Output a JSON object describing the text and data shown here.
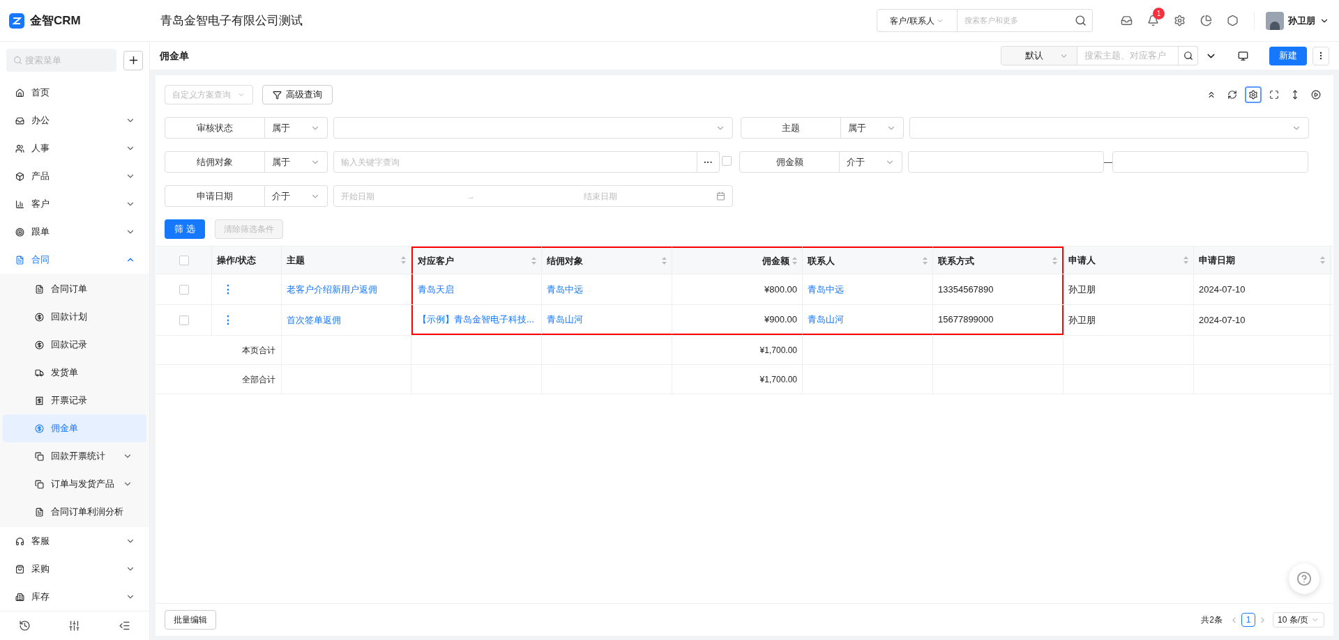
{
  "header": {
    "logo": "金智CRM",
    "company": "青岛金智电子有限公司测试",
    "search_scope": "客户/联系人",
    "search_placeholder": "搜索客户和更多",
    "notification_count": "1",
    "user": "孙卫朋"
  },
  "sidebar": {
    "search_placeholder": "搜索菜单",
    "items": [
      {
        "label": "首页",
        "kind": "link",
        "selected": false
      },
      {
        "label": "办公",
        "kind": "group",
        "expanded": false,
        "selected": false
      },
      {
        "label": "人事",
        "kind": "group",
        "expanded": false,
        "selected": false
      },
      {
        "label": "产品",
        "kind": "group",
        "expanded": false,
        "selected": false
      },
      {
        "label": "客户",
        "kind": "group",
        "expanded": false,
        "selected": false
      },
      {
        "label": "跟单",
        "kind": "group",
        "expanded": false,
        "selected": false
      },
      {
        "label": "合同",
        "kind": "group",
        "expanded": true,
        "selected": true,
        "children": [
          {
            "label": "合同订单",
            "kind": "link",
            "selected": false
          },
          {
            "label": "回款计划",
            "kind": "link",
            "selected": false
          },
          {
            "label": "回款记录",
            "kind": "link",
            "selected": false
          },
          {
            "label": "发货单",
            "kind": "link",
            "selected": false
          },
          {
            "label": "开票记录",
            "kind": "link",
            "selected": false
          },
          {
            "label": "佣金单",
            "kind": "link",
            "selected": true
          },
          {
            "label": "回款开票统计",
            "kind": "group",
            "expanded": false,
            "selected": false
          },
          {
            "label": "订单与发货产品",
            "kind": "group",
            "expanded": false,
            "selected": false
          },
          {
            "label": "合同订单利润分析",
            "kind": "link",
            "selected": false
          }
        ]
      },
      {
        "label": "客服",
        "kind": "group",
        "expanded": false,
        "selected": false
      },
      {
        "label": "采购",
        "kind": "group",
        "expanded": false,
        "selected": false
      },
      {
        "label": "库存",
        "kind": "group",
        "expanded": false,
        "selected": false
      }
    ]
  },
  "page": {
    "title": "佣金单",
    "view": "默认",
    "search_placeholder": "搜索主题、对应客户",
    "new_button": "新建"
  },
  "toolbar": {
    "scheme_placeholder": "自定义方案查询",
    "advanced": "高级查询",
    "tools": [
      {
        "selected": false
      },
      {
        "selected": false
      },
      {
        "selected": true
      },
      {
        "selected": false
      },
      {
        "selected": false
      },
      {
        "selected": false
      }
    ]
  },
  "filters": [
    {
      "label": "审核状态",
      "operator": "属于",
      "kind": "select"
    },
    {
      "label": "主题",
      "operator": "属于",
      "kind": "select"
    },
    {
      "label": "结佣对象",
      "operator": "属于",
      "kind": "keyword",
      "placeholder": "输入关键字查询",
      "more": "···",
      "checked": false
    },
    {
      "label": "佣金额",
      "operator": "介于",
      "kind": "range",
      "separator": "—"
    },
    {
      "label": "申请日期",
      "operator": "介于",
      "kind": "daterange",
      "start_placeholder": "开始日期",
      "end_placeholder": "结束日期",
      "separator": "→"
    }
  ],
  "filter_actions": {
    "apply": "筛 选",
    "clear": "清除筛选条件",
    "clear_disabled": true
  },
  "table": {
    "select_all_checked": false,
    "columns": [
      {
        "label": "操作/状态",
        "kind": "menu",
        "sortable": false,
        "highlighted": false
      },
      {
        "label": "主题",
        "kind": "link",
        "sortable": true,
        "highlighted": false
      },
      {
        "label": "对应客户",
        "kind": "link",
        "sortable": true,
        "highlighted": true
      },
      {
        "label": "结佣对象",
        "kind": "link",
        "sortable": true,
        "highlighted": true
      },
      {
        "label": "佣金额",
        "kind": "amount",
        "sortable": true,
        "highlighted": true
      },
      {
        "label": "联系人",
        "kind": "link",
        "sortable": true,
        "highlighted": true
      },
      {
        "label": "联系方式",
        "kind": "text",
        "sortable": true,
        "highlighted": true
      },
      {
        "label": "申请人",
        "kind": "text",
        "sortable": true,
        "highlighted": false
      },
      {
        "label": "申请日期",
        "kind": "text",
        "sortable": true,
        "highlighted": false
      }
    ],
    "rows": [
      {
        "checked": false,
        "cells": [
          "⋮",
          "老客户介绍新用户返佣",
          "青岛天启",
          "青岛中远",
          "¥800.00",
          "青岛中远",
          "13354567890",
          "孙卫朋",
          "2024-07-10"
        ]
      },
      {
        "checked": false,
        "cells": [
          "⋮",
          "首次签单返佣",
          "【示例】青岛金智电子科技...",
          "青岛山河",
          "¥900.00",
          "青岛山河",
          "15677899000",
          "孙卫朋",
          "2024-07-10"
        ]
      }
    ],
    "totals": [
      {
        "label": "本页合计",
        "amount": "¥1,700.00"
      },
      {
        "label": "全部合计",
        "amount": "¥1,700.00"
      }
    ]
  },
  "footer": {
    "batch_edit": "批量编辑",
    "total": "共2条",
    "pages": [
      {
        "label": "1",
        "selected": true
      }
    ],
    "page_size": "10 条/页"
  }
}
